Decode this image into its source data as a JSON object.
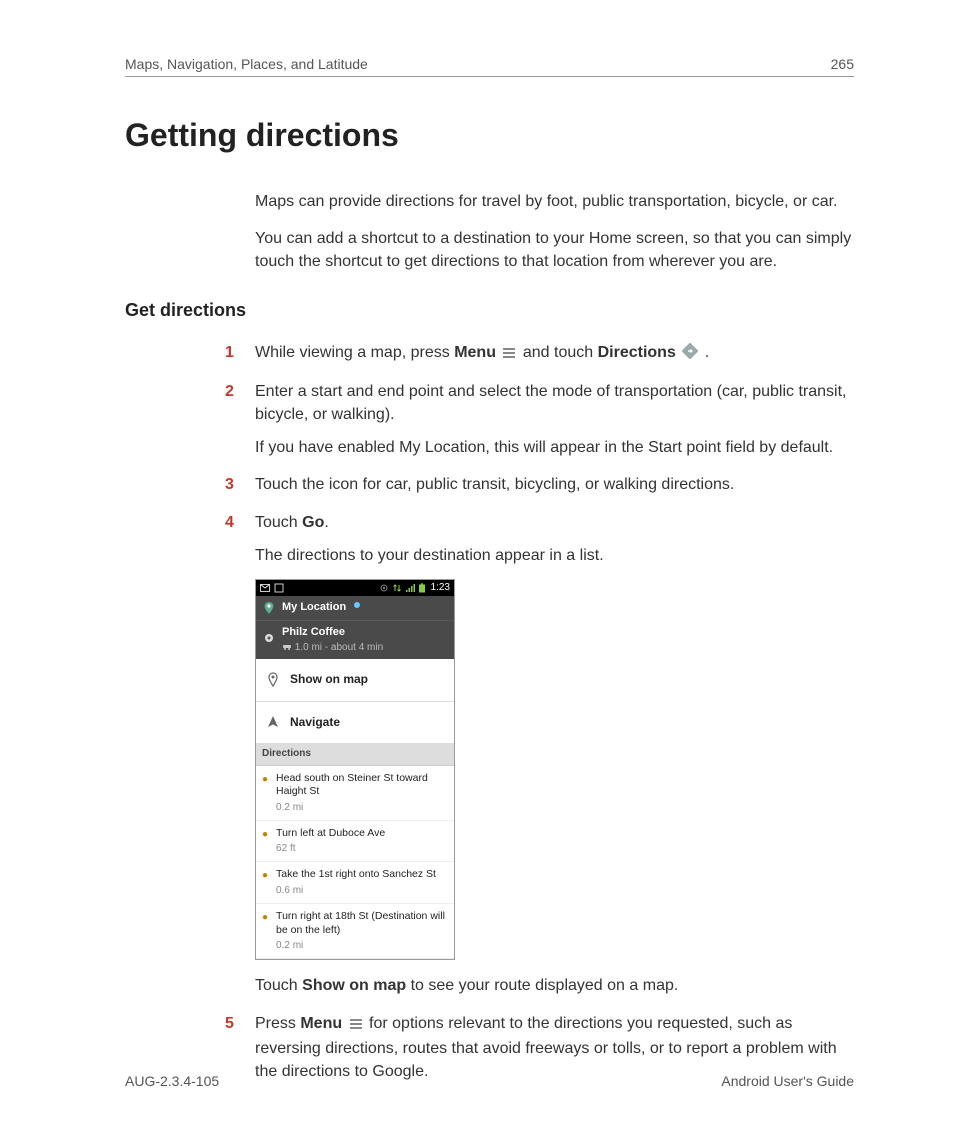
{
  "header": {
    "breadcrumb": "Maps, Navigation, Places, and Latitude",
    "page_number": "265"
  },
  "title": "Getting directions",
  "intro": {
    "p1": "Maps can provide directions for travel by foot, public transportation, bicycle, or car.",
    "p2": "You can add a shortcut to a destination to your Home screen, so that you can simply touch the shortcut to get directions to that location from wherever you are."
  },
  "section_title": "Get directions",
  "steps": {
    "n1": "1",
    "s1a": "While viewing a map, press ",
    "s1_menu": "Menu",
    "s1b": " and touch ",
    "s1_dir": "Directions",
    "s1c": " .",
    "n2": "2",
    "s2": "Enter a start and end point and select the mode of transportation (car, public transit, bicycle, or walking).",
    "s2_sub": "If you have enabled My Location, this will appear in the Start point field by default.",
    "n3": "3",
    "s3": "Touch the icon for car, public transit, bicycling, or walking directions.",
    "n4": "4",
    "s4a": "Touch ",
    "s4_go": "Go",
    "s4b": ".",
    "s4_sub": "The directions to your destination appear in a list.",
    "s4_touch_a": "Touch ",
    "s4_show": "Show on map",
    "s4_touch_b": " to see your route displayed on a map.",
    "n5": "5",
    "s5a": "Press ",
    "s5_menu": "Menu",
    "s5b": " for options relevant to the directions you requested, such as reversing directions, routes that avoid freeways or tolls, or to report a problem with the directions to Google."
  },
  "phone": {
    "time": "1:23",
    "my_location": "My Location",
    "dest": "Philz Coffee",
    "dest_sub": "1.0 mi - about 4 min",
    "show_on_map": "Show on map",
    "navigate": "Navigate",
    "dir_header": "Directions",
    "d1": "Head south on Steiner St toward Haight St",
    "d1_dist": "0.2 mi",
    "d2": "Turn left at Duboce Ave",
    "d2_dist": "62 ft",
    "d3": "Take the 1st right onto Sanchez St",
    "d3_dist": "0.6 mi",
    "d4": "Turn right at 18th St (Destination will be on the left)",
    "d4_dist": "0.2 mi"
  },
  "footer": {
    "left": "AUG-2.3.4-105",
    "right": "Android User's Guide"
  }
}
